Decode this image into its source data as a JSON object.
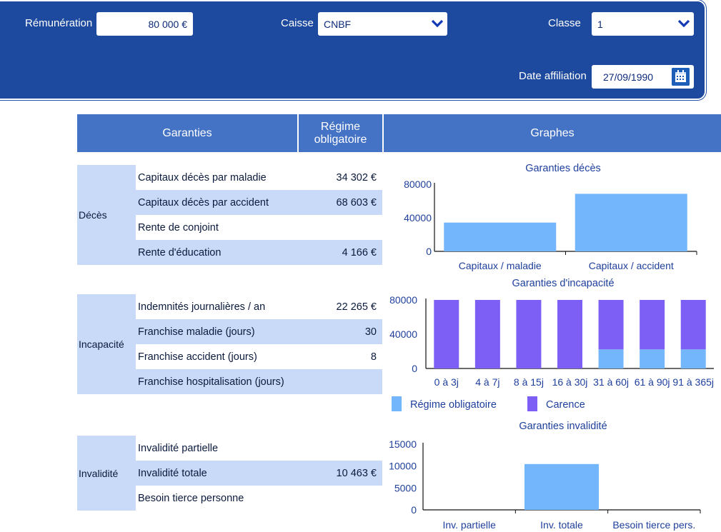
{
  "header": {
    "remuneration_label": "Rémunération",
    "remuneration_value": "80 000 €",
    "caisse_label": "Caisse",
    "caisse_value": "CNBF",
    "classe_label": "Classe",
    "classe_value": "1",
    "date_label": "Date affiliation",
    "date_value": "27/09/1990"
  },
  "table": {
    "col_garanties": "Garanties",
    "col_regime": "Régime obligatoire",
    "col_graphes": "Graphes"
  },
  "deces": {
    "label": "Décès",
    "rows": [
      {
        "label": "Capitaux décès par maladie",
        "value": "34 302 €"
      },
      {
        "label": "Capitaux décès par accident",
        "value": "68 603 €"
      },
      {
        "label": "Rente de conjoint",
        "value": ""
      },
      {
        "label": "Rente d'éducation",
        "value": "4 166 €"
      }
    ]
  },
  "incapacite": {
    "label": "Incapacité",
    "rows": [
      {
        "label": "Indemnités journalières / an",
        "value": "22 265 €"
      },
      {
        "label": "Franchise maladie (jours)",
        "value": "30"
      },
      {
        "label": "Franchise accident (jours)",
        "value": "8"
      },
      {
        "label": "Franchise hospitalisation (jours)",
        "value": ""
      }
    ]
  },
  "invalidite": {
    "label": "Invalidité",
    "rows": [
      {
        "label": "Invalidité partielle",
        "value": ""
      },
      {
        "label": "Invalidité totale",
        "value": "10 463 €"
      },
      {
        "label": "Besoin tierce personne",
        "value": ""
      }
    ]
  },
  "colors": {
    "regime": "#73b6fb",
    "carence": "#7e5ff6",
    "axis_text": "#1e3f9c"
  },
  "chart_data": [
    {
      "type": "bar",
      "title": "Garanties décès",
      "categories": [
        "Capitaux / maladie",
        "Capitaux / accident"
      ],
      "values": [
        34302,
        68603
      ],
      "yticks": [
        "0",
        "40000",
        "80000"
      ],
      "ylim": [
        0,
        80000
      ]
    },
    {
      "type": "bar",
      "title": "Garanties d'incapacité",
      "stacked": true,
      "categories": [
        "0 à 3j",
        "4 à 7j",
        "8 à 15j",
        "16 à 30j",
        "31 à 60j",
        "61 à 90j",
        "91 à 365j"
      ],
      "series": [
        {
          "name": "Régime obligatoire",
          "values": [
            0,
            0,
            0,
            0,
            22265,
            22265,
            22265
          ]
        },
        {
          "name": "Carence",
          "values": [
            80000,
            80000,
            80000,
            80000,
            57735,
            57735,
            57735
          ]
        }
      ],
      "yticks": [
        "0",
        "40000",
        "80000"
      ],
      "ylim": [
        0,
        80000
      ],
      "legend": "bottom"
    },
    {
      "type": "bar",
      "title": "Garanties invalidité",
      "categories": [
        "Inv. partielle",
        "Inv. totale",
        "Besoin tierce pers."
      ],
      "values": [
        0,
        10463,
        0
      ],
      "yticks": [
        "0",
        "5000",
        "10000",
        "15000"
      ],
      "ylim": [
        0,
        15000
      ]
    }
  ]
}
